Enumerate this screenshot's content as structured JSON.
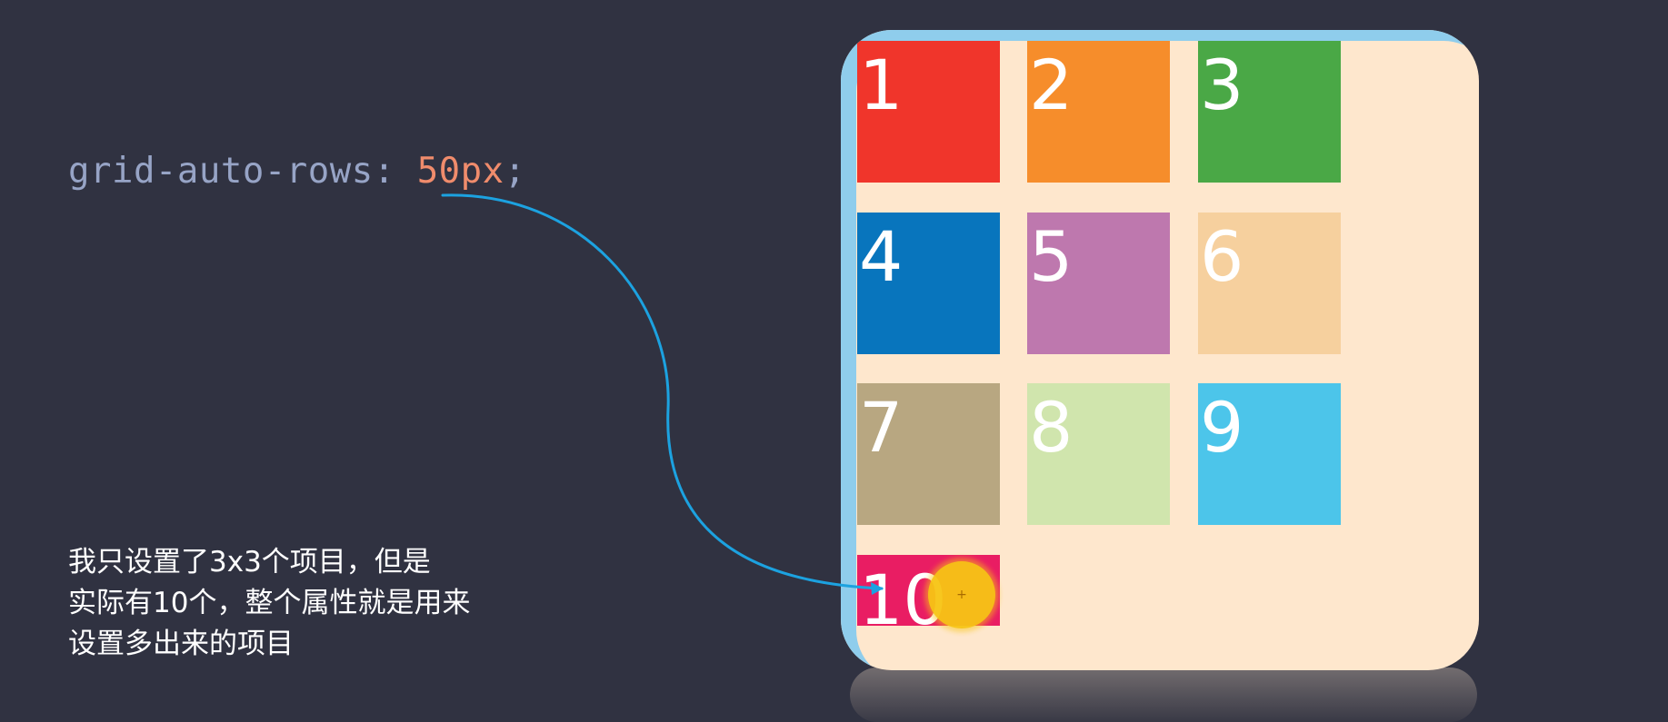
{
  "code": {
    "property": "grid-auto-rows: ",
    "value": "50px",
    "semicolon": ";"
  },
  "caption": {
    "lines": [
      "我只设置了3x3个项目，但是",
      "实际有10个，整个属性就是用来",
      "设置多出来的项目"
    ]
  },
  "grid": {
    "items": [
      {
        "label": "1",
        "color": "#f0352b"
      },
      {
        "label": "2",
        "color": "#f68d2b"
      },
      {
        "label": "3",
        "color": "#4aa846"
      },
      {
        "label": "4",
        "color": "#0875bd"
      },
      {
        "label": "5",
        "color": "#be78ae"
      },
      {
        "label": "6",
        "color": "#f6d09e"
      },
      {
        "label": "7",
        "color": "#b8a781"
      },
      {
        "label": "8",
        "color": "#d0e5ad"
      },
      {
        "label": "9",
        "color": "#4cc5ea"
      },
      {
        "label": "10",
        "color": "#e91d63"
      }
    ],
    "container_color": "#fee7cd",
    "container_border_color": "#8fcdec"
  },
  "arrow_color": "#1ca2e0",
  "cursor_color": "#f7c514"
}
